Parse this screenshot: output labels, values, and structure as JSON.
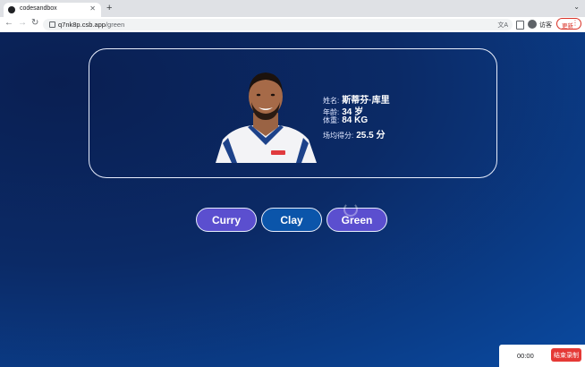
{
  "browser": {
    "tab_title": "codesandbox",
    "url_domain": "q7nk8p.csb.app",
    "url_path": "/green",
    "profile_label": "访客",
    "update_label": "更新"
  },
  "player": {
    "name_label": "姓名:",
    "name_value": "斯蒂芬·库里",
    "age_label": "年龄:",
    "age_value": "34 岁",
    "weight_label": "体重:",
    "weight_value": "84 KG",
    "ppg_label": "场均得分:",
    "ppg_value": "25.5 分"
  },
  "buttons": {
    "curry": "Curry",
    "clay": "Clay",
    "green": "Green"
  },
  "recorder": {
    "time": "00:00",
    "stop_label": "结束录制"
  },
  "colors": {
    "button_purple": "#5b4fcf",
    "button_blue": "#0b55aa",
    "page_bg_dark": "#0a1f52",
    "page_bg_light": "#0a4aa1"
  }
}
